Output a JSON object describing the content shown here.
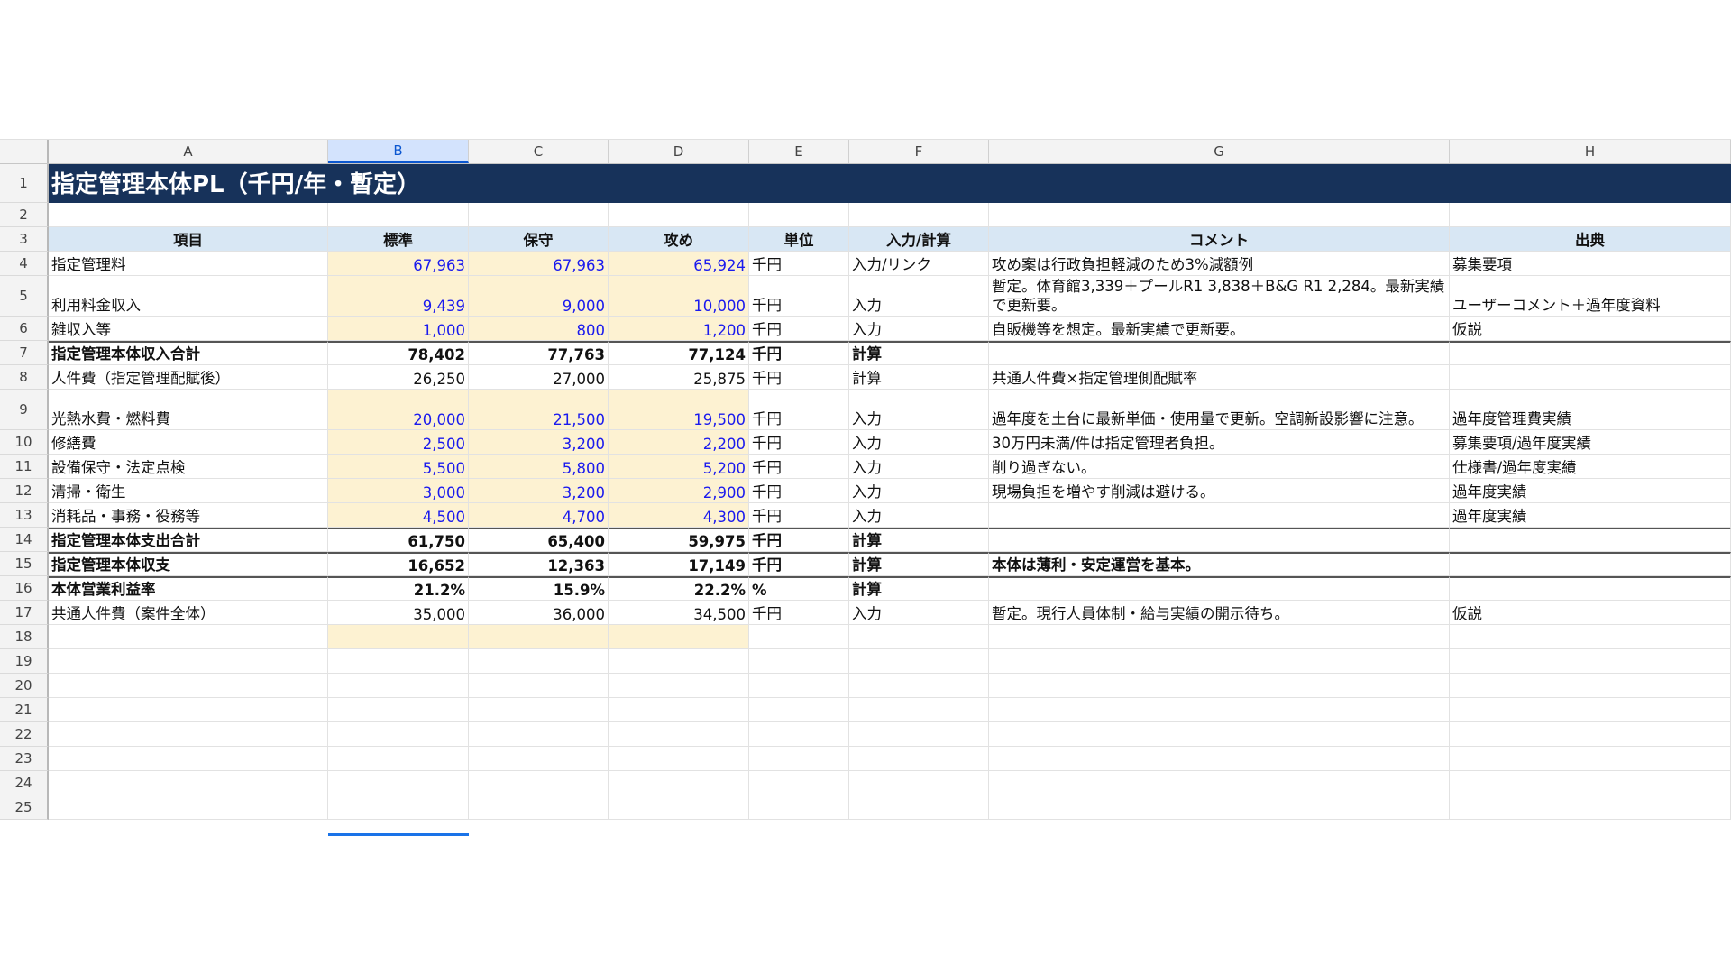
{
  "columns": [
    "A",
    "B",
    "C",
    "D",
    "E",
    "F",
    "G",
    "H"
  ],
  "selected_column": "B",
  "title": "指定管理本体PL（千円/年・暫定）",
  "headers": {
    "item": "項目",
    "std": "標準",
    "con": "保守",
    "agg": "攻め",
    "unit": "単位",
    "type": "入力/計算",
    "comment": "コメント",
    "source": "出典"
  },
  "rows": [
    {
      "n": "4",
      "item": "指定管理料",
      "std": "67,963",
      "con": "67,963",
      "agg": "65,924",
      "unit": "千円",
      "type": "入力/リンク",
      "comment": "攻め案は行政負担軽減のため3%減額例",
      "source": "募集要項"
    },
    {
      "n": "5",
      "item": "利用料金収入",
      "std": "9,439",
      "con": "9,000",
      "agg": "10,000",
      "unit": "千円",
      "type": "入力",
      "comment": "暫定。体育館3,339＋プールR1 3,838＋B&G R1 2,284。最新実績で更新要。",
      "source": "ユーザーコメント＋過年度資料"
    },
    {
      "n": "6",
      "item": "雑収入等",
      "std": "1,000",
      "con": "800",
      "agg": "1,200",
      "unit": "千円",
      "type": "入力",
      "comment": "自販機等を想定。最新実績で更新要。",
      "source": "仮説"
    },
    {
      "n": "7",
      "item": "指定管理本体収入合計",
      "std": "78,402",
      "con": "77,763",
      "agg": "77,124",
      "unit": "千円",
      "type": "計算",
      "comment": "",
      "source": ""
    },
    {
      "n": "8",
      "item": "人件費（指定管理配賦後）",
      "std": "26,250",
      "con": "27,000",
      "agg": "25,875",
      "unit": "千円",
      "type": "計算",
      "comment": "共通人件費×指定管理側配賦率",
      "source": ""
    },
    {
      "n": "9",
      "item": "光熱水費・燃料費",
      "std": "20,000",
      "con": "21,500",
      "agg": "19,500",
      "unit": "千円",
      "type": "入力",
      "comment": "過年度を土台に最新単価・使用量で更新。空調新設影響に注意。",
      "source": "過年度管理費実績"
    },
    {
      "n": "10",
      "item": "修繕費",
      "std": "2,500",
      "con": "3,200",
      "agg": "2,200",
      "unit": "千円",
      "type": "入力",
      "comment": "30万円未満/件は指定管理者負担。",
      "source": "募集要項/過年度実績"
    },
    {
      "n": "11",
      "item": "設備保守・法定点検",
      "std": "5,500",
      "con": "5,800",
      "agg": "5,200",
      "unit": "千円",
      "type": "入力",
      "comment": "削り過ぎない。",
      "source": "仕様書/過年度実績"
    },
    {
      "n": "12",
      "item": "清掃・衛生",
      "std": "3,000",
      "con": "3,200",
      "agg": "2,900",
      "unit": "千円",
      "type": "入力",
      "comment": "現場負担を増やす削減は避ける。",
      "source": "過年度実績"
    },
    {
      "n": "13",
      "item": "消耗品・事務・役務等",
      "std": "4,500",
      "con": "4,700",
      "agg": "4,300",
      "unit": "千円",
      "type": "入力",
      "comment": "",
      "source": "過年度実績"
    },
    {
      "n": "14",
      "item": "指定管理本体支出合計",
      "std": "61,750",
      "con": "65,400",
      "agg": "59,975",
      "unit": "千円",
      "type": "計算",
      "comment": "",
      "source": ""
    },
    {
      "n": "15",
      "item": "指定管理本体収支",
      "std": "16,652",
      "con": "12,363",
      "agg": "17,149",
      "unit": "千円",
      "type": "計算",
      "comment": "本体は薄利・安定運営を基本。",
      "source": ""
    },
    {
      "n": "16",
      "item": "本体営業利益率",
      "std": "21.2%",
      "con": "15.9%",
      "agg": "22.2%",
      "unit": "%",
      "type": "計算",
      "comment": "",
      "source": ""
    },
    {
      "n": "17",
      "item": "共通人件費（案件全体）",
      "std": "35,000",
      "con": "36,000",
      "agg": "34,500",
      "unit": "千円",
      "type": "入力",
      "comment": "暫定。現行人員体制・給与実績の開示待ち。",
      "source": "仮説"
    }
  ],
  "empty_rows": [
    "18",
    "19",
    "20",
    "21",
    "22",
    "23",
    "24",
    "25"
  ],
  "colors": {
    "title_bg": "#17325a",
    "header_bg": "#d8e7f4",
    "input_bg": "#fdf2d2",
    "input_text": "#1a1aee",
    "selection": "#1a73e8"
  }
}
